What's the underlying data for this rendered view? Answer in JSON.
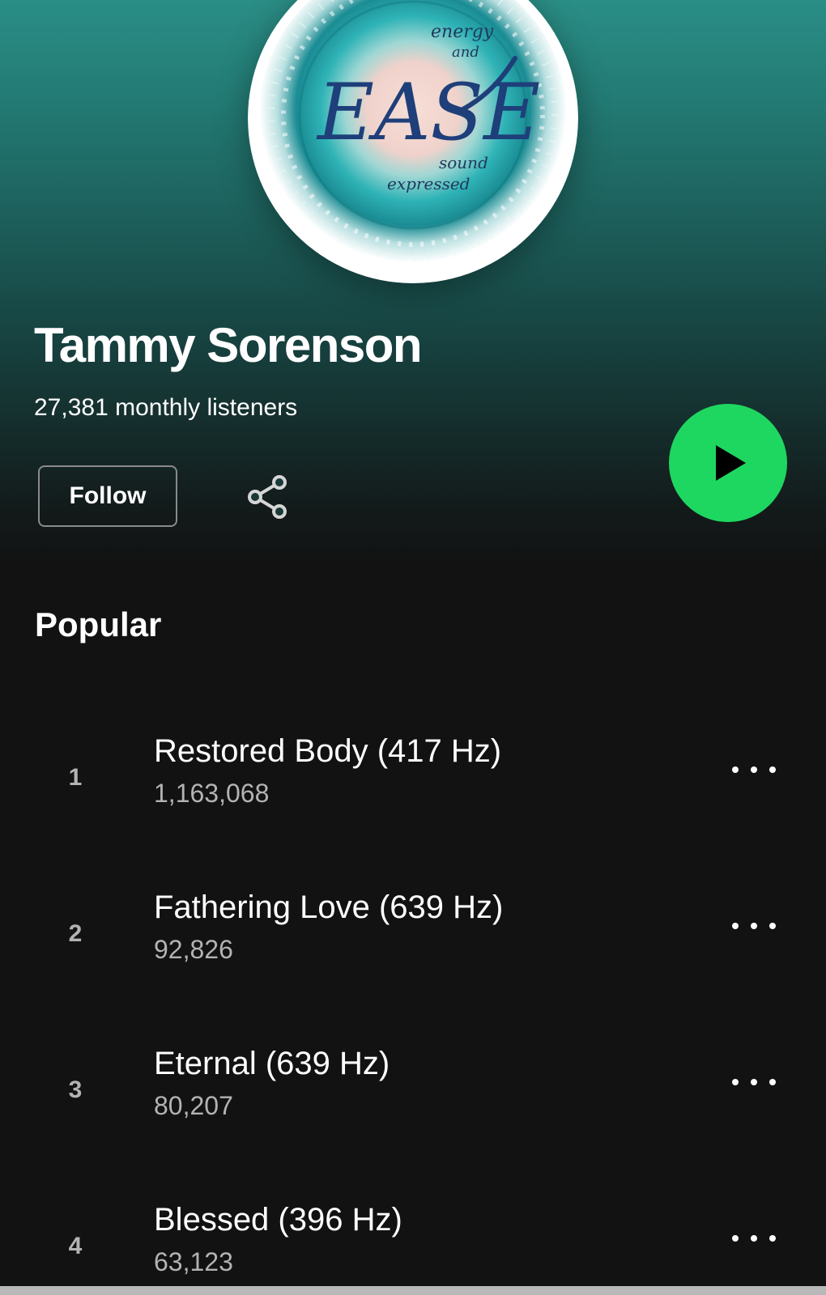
{
  "artist": {
    "name": "Tammy Sorenson",
    "monthly_listeners": "27,381 monthly listeners",
    "cover_text": {
      "top": "energy",
      "and": "and",
      "main": "EASE",
      "sound": "sound",
      "expressed": "expressed"
    }
  },
  "actions": {
    "follow_label": "Follow",
    "share_icon": "share-icon",
    "play_icon": "play-icon"
  },
  "popular": {
    "title": "Popular",
    "tracks": [
      {
        "number": "1",
        "title": "Restored Body (417 Hz)",
        "plays": "1,163,068"
      },
      {
        "number": "2",
        "title": "Fathering Love (639 Hz)",
        "plays": "92,826"
      },
      {
        "number": "3",
        "title": "Eternal (639 Hz)",
        "plays": "80,207"
      },
      {
        "number": "4",
        "title": "Blessed (396 Hz)",
        "plays": "63,123"
      }
    ]
  },
  "colors": {
    "accent_green": "#1ed760",
    "header_teal": "#2a8e86",
    "background": "#121212",
    "secondary_text": "#b3b3b3"
  }
}
